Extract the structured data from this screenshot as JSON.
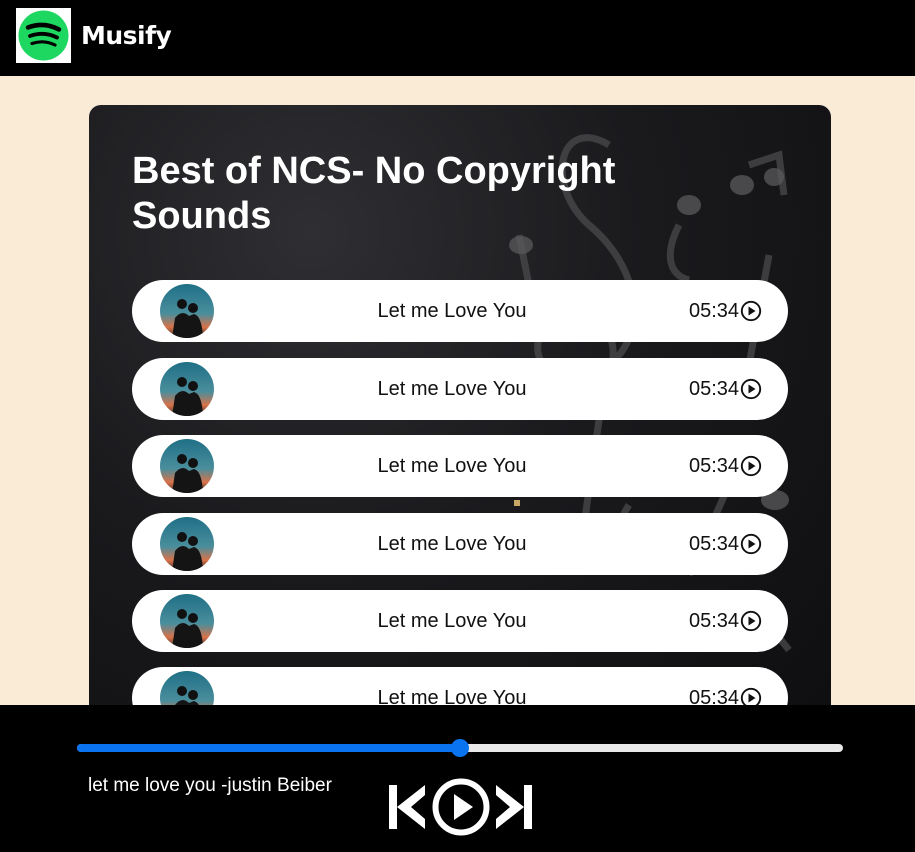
{
  "navbar": {
    "brand": "Musify",
    "logo_icon": "spotify-logo-icon",
    "colors": {
      "background": "#000000",
      "logo_green": "#1ed760"
    }
  },
  "playlist": {
    "title": "Best of NCS- No Copyright Sounds",
    "songs": [
      {
        "name": "Let me Love You",
        "duration": "05:34",
        "cover_icon": "couple-sunset-cover-icon",
        "action_icon": "play-circle-icon"
      },
      {
        "name": "Let me Love You",
        "duration": "05:34",
        "cover_icon": "couple-sunset-cover-icon",
        "action_icon": "play-circle-icon"
      },
      {
        "name": "Let me Love You",
        "duration": "05:34",
        "cover_icon": "couple-sunset-cover-icon",
        "action_icon": "play-circle-icon"
      },
      {
        "name": "Let me Love You",
        "duration": "05:34",
        "cover_icon": "couple-sunset-cover-icon",
        "action_icon": "play-circle-icon"
      },
      {
        "name": "Let me Love You",
        "duration": "05:34",
        "cover_icon": "couple-sunset-cover-icon",
        "action_icon": "play-circle-icon"
      },
      {
        "name": "Let me Love You",
        "duration": "05:34",
        "cover_icon": "couple-sunset-cover-icon",
        "action_icon": "play-circle-icon"
      }
    ]
  },
  "player": {
    "now_playing": "let me love you -justin Beiber",
    "progress_percent": 50,
    "controls": [
      "skip-back-icon",
      "play-circle-icon",
      "skip-forward-icon"
    ],
    "colors": {
      "progress": "#0a74f0",
      "track": "#e9e9e9"
    }
  },
  "page": {
    "background": "#faebd7"
  }
}
